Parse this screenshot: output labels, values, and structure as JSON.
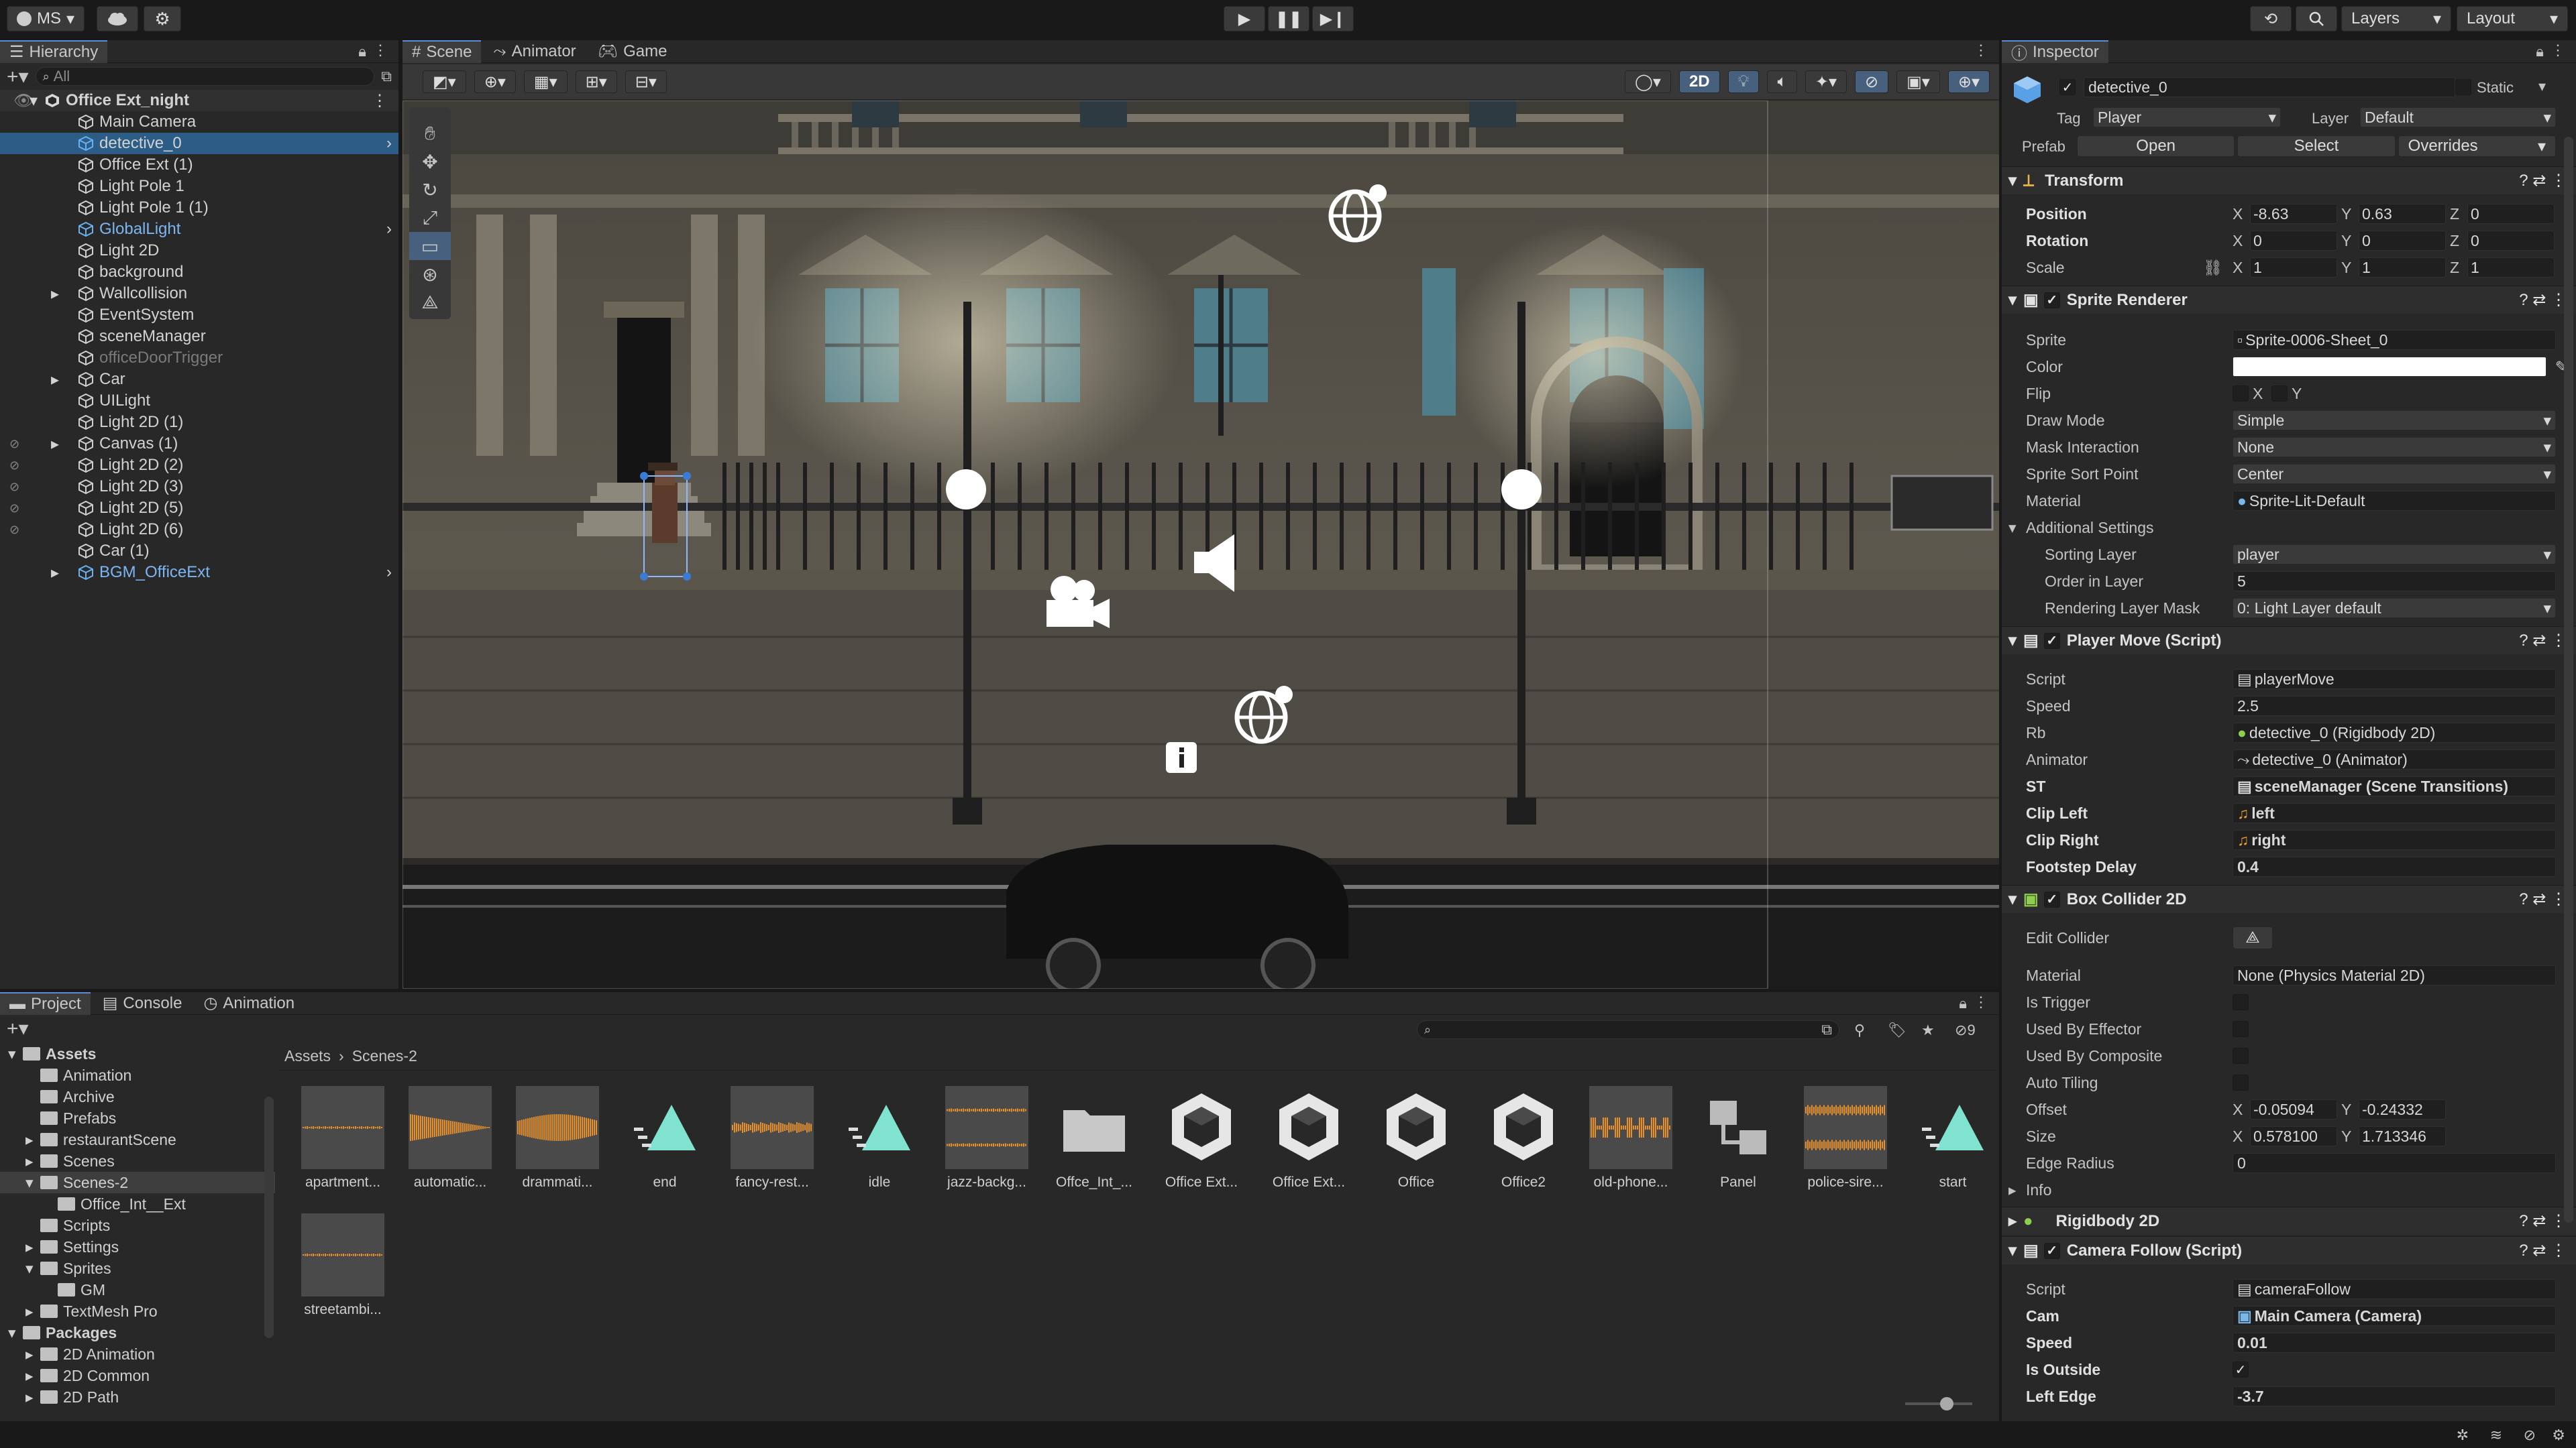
{
  "topbar": {
    "account": "MS",
    "layers": "Layers",
    "layout": "Layout"
  },
  "hierarchy": {
    "tab": "Hierarchy",
    "search_placeholder": "All",
    "scene": "Office Ext_night",
    "items": [
      {
        "label": "Main Camera"
      },
      {
        "label": "detective_0"
      },
      {
        "label": "Office Ext (1)"
      },
      {
        "label": "Light Pole 1"
      },
      {
        "label": "Light Pole 1 (1)"
      },
      {
        "label": "GlobalLight"
      },
      {
        "label": "Light 2D"
      },
      {
        "label": "background"
      },
      {
        "label": "Wallcollision"
      },
      {
        "label": "EventSystem"
      },
      {
        "label": "sceneManager"
      },
      {
        "label": "officeDoorTrigger"
      },
      {
        "label": "Car"
      },
      {
        "label": "UILight"
      },
      {
        "label": "Light 2D (1)"
      },
      {
        "label": "Canvas (1)"
      },
      {
        "label": "Light 2D (2)"
      },
      {
        "label": "Light 2D (3)"
      },
      {
        "label": "Light 2D (5)"
      },
      {
        "label": "Light 2D (6)"
      },
      {
        "label": "Car (1)"
      },
      {
        "label": "BGM_OfficeExt"
      }
    ]
  },
  "scene": {
    "tabs": [
      "Scene",
      "Animator",
      "Game"
    ],
    "mode_2d": "2D"
  },
  "inspector": {
    "tab": "Inspector",
    "object_name": "detective_0",
    "static_label": "Static",
    "tag_label": "Tag",
    "tag_value": "Player",
    "layer_label": "Layer",
    "layer_value": "Default",
    "prefab_label": "Prefab",
    "prefab_open": "Open",
    "prefab_select": "Select",
    "prefab_overrides": "Overrides",
    "transform": {
      "title": "Transform",
      "position_label": "Position",
      "position": [
        "-8.63",
        "0.63",
        "0"
      ],
      "rotation_label": "Rotation",
      "rotation": [
        "0",
        "0",
        "0"
      ],
      "scale_label": "Scale",
      "scale": [
        "1",
        "1",
        "1"
      ]
    },
    "sprite_renderer": {
      "title": "Sprite Renderer",
      "sprite_label": "Sprite",
      "sprite": "Sprite-0006-Sheet_0",
      "color_label": "Color",
      "flip_label": "Flip",
      "flip_x": "X",
      "flip_y": "Y",
      "draw_mode_label": "Draw Mode",
      "draw_mode": "Simple",
      "mask_label": "Mask Interaction",
      "mask": "None",
      "sort_point_label": "Sprite Sort Point",
      "sort_point": "Center",
      "material_label": "Material",
      "material": "Sprite-Lit-Default",
      "additional": "Additional Settings",
      "sorting_layer_label": "Sorting Layer",
      "sorting_layer": "player",
      "order_label": "Order in Layer",
      "order": "5",
      "rlm_label": "Rendering Layer Mask",
      "rlm": "0: Light Layer default"
    },
    "player_move": {
      "title": "Player Move (Script)",
      "script_label": "Script",
      "script": "playerMove",
      "speed_label": "Speed",
      "speed": "2.5",
      "rb_label": "Rb",
      "rb": "detective_0 (Rigidbody 2D)",
      "animator_label": "Animator",
      "animator": "detective_0 (Animator)",
      "st_label": "ST",
      "st": "sceneManager (Scene Transitions)",
      "clip_left_label": "Clip Left",
      "clip_left": "left",
      "clip_right_label": "Clip Right",
      "clip_right": "right",
      "footstep_label": "Footstep Delay",
      "footstep": "0.4"
    },
    "box_collider": {
      "title": "Box Collider 2D",
      "edit_label": "Edit Collider",
      "material_label": "Material",
      "material": "None (Physics Material 2D)",
      "trigger_label": "Is Trigger",
      "effector_label": "Used By Effector",
      "composite_label": "Used By Composite",
      "tiling_label": "Auto Tiling",
      "offset_label": "Offset",
      "offset": [
        "-0.05094",
        "-0.24332"
      ],
      "size_label": "Size",
      "size": [
        "0.578100",
        "1.713346"
      ],
      "edge_label": "Edge Radius",
      "edge": "0",
      "info_label": "Info"
    },
    "rigidbody": {
      "title": "Rigidbody 2D"
    },
    "camera_follow": {
      "title": "Camera Follow (Script)",
      "script_label": "Script",
      "script": "cameraFollow",
      "cam_label": "Cam",
      "cam": "Main Camera (Camera)",
      "speed_label": "Speed",
      "speed": "0.01",
      "outside_label": "Is Outside",
      "left_edge_label": "Left Edge",
      "left_edge": "-3.7"
    }
  },
  "project": {
    "tabs": [
      "Project",
      "Console",
      "Animation"
    ],
    "hidden_count": "9",
    "breadcrumb": [
      "Assets",
      "Scenes-2"
    ],
    "tree": [
      {
        "label": "Assets",
        "level": 0,
        "bold": true
      },
      {
        "label": "Animation",
        "level": 1
      },
      {
        "label": "Archive",
        "level": 1
      },
      {
        "label": "Prefabs",
        "level": 1
      },
      {
        "label": "restaurantScene",
        "level": 1
      },
      {
        "label": "Scenes",
        "level": 1
      },
      {
        "label": "Scenes-2",
        "level": 1
      },
      {
        "label": "Office_Int__Ext",
        "level": 2
      },
      {
        "label": "Scripts",
        "level": 1
      },
      {
        "label": "Settings",
        "level": 1
      },
      {
        "label": "Sprites",
        "level": 1
      },
      {
        "label": "GM",
        "level": 2
      },
      {
        "label": "TextMesh Pro",
        "level": 1
      },
      {
        "label": "Packages",
        "level": 0,
        "bold": true
      },
      {
        "label": "2D Animation",
        "level": 1
      },
      {
        "label": "2D Common",
        "level": 1
      },
      {
        "label": "2D Path",
        "level": 1
      }
    ],
    "assets": [
      {
        "label": "apartment...",
        "kind": "audio-thin"
      },
      {
        "label": "automatic...",
        "kind": "audio-fade"
      },
      {
        "label": "drammati...",
        "kind": "audio-big"
      },
      {
        "label": "end",
        "kind": "anim"
      },
      {
        "label": "fancy-rest...",
        "kind": "audio-mid"
      },
      {
        "label": "idle",
        "kind": "anim"
      },
      {
        "label": "jazz-backg...",
        "kind": "audio-double"
      },
      {
        "label": "Offce_Int_...",
        "kind": "folder"
      },
      {
        "label": "Office Ext...",
        "kind": "unity"
      },
      {
        "label": "Office Ext...",
        "kind": "unity"
      },
      {
        "label": "Office",
        "kind": "unity"
      },
      {
        "label": "Office2",
        "kind": "unity"
      },
      {
        "label": "old-phone...",
        "kind": "audio-spiky"
      },
      {
        "label": "Panel",
        "kind": "prefab"
      },
      {
        "label": "police-sire...",
        "kind": "audio-double-dense"
      },
      {
        "label": "start",
        "kind": "anim"
      },
      {
        "label": "streetambi...",
        "kind": "audio-thin"
      }
    ]
  }
}
